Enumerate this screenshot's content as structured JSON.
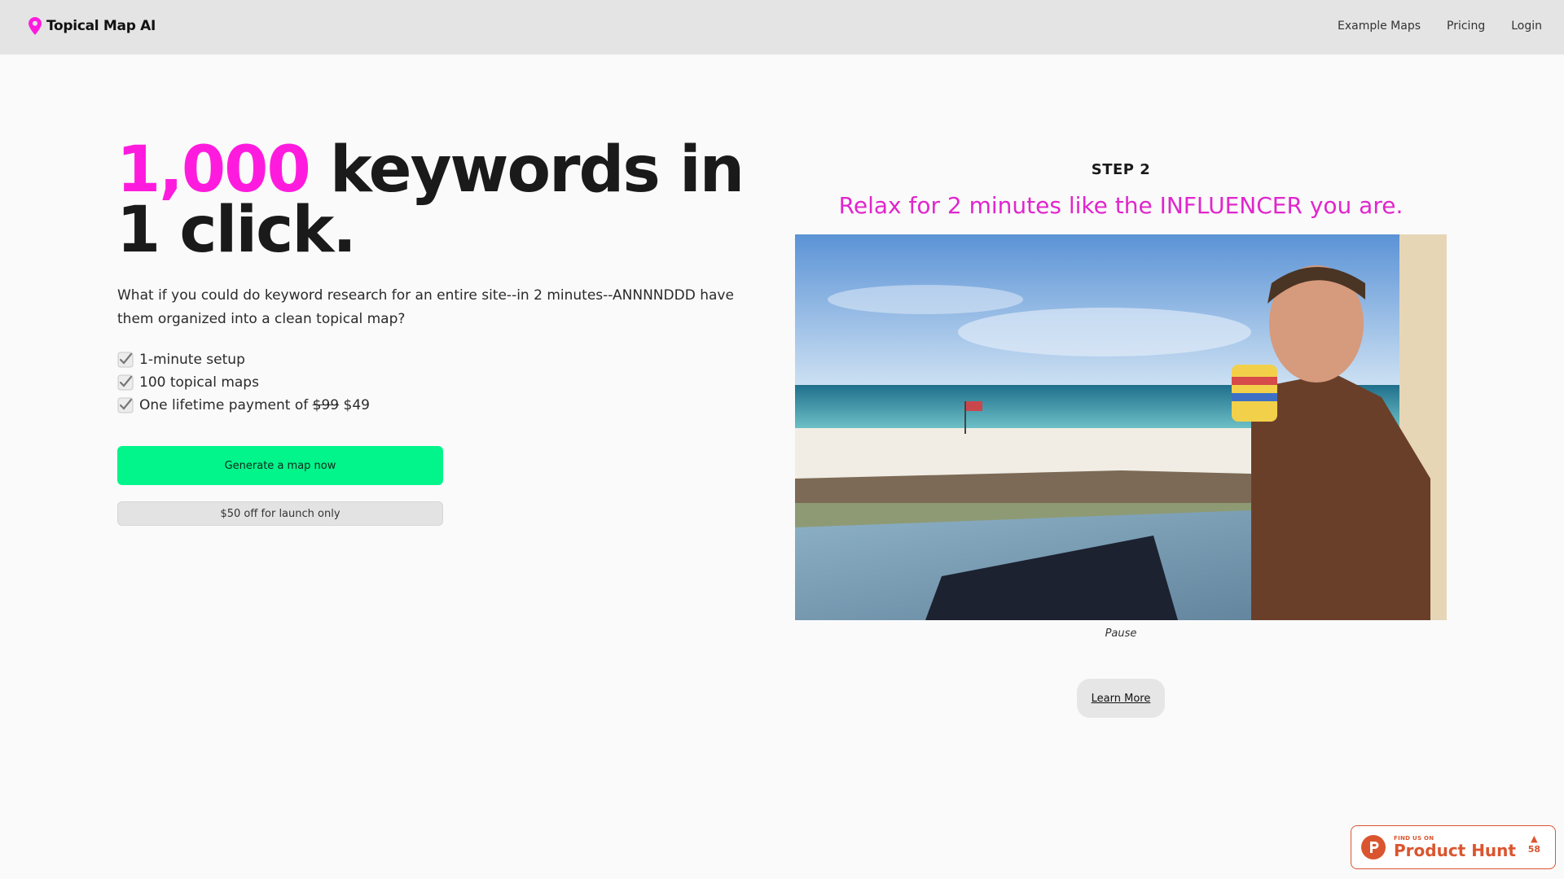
{
  "nav": {
    "brand": "Topical Map AI",
    "links": [
      "Example Maps",
      "Pricing",
      "Login"
    ]
  },
  "hero": {
    "heading_accent": "1,000",
    "heading_rest": " keywords in 1 click.",
    "description": "What if you could do keyword research for an entire site--in 2 minutes--ANNNNDDD have them organized into a clean topical map?",
    "features": {
      "setup": "1-minute setup",
      "maps": "100 topical maps",
      "payment_prefix": "One lifetime payment of ",
      "old_price": "$99",
      "new_price": " $49"
    },
    "cta_label": "Generate a map now",
    "promo_label": "$50 off for launch only"
  },
  "step": {
    "label": "STEP 2",
    "subtitle": "Relax for 2 minutes like the INFLUENCER you are.",
    "video_caption": "Pause",
    "learn_more": "Learn More"
  },
  "product_hunt": {
    "small": "FIND US ON",
    "name": "Product Hunt",
    "votes": "58"
  },
  "colors": {
    "accent_pink": "#ff1bde",
    "cta_green": "#02f58b",
    "product_hunt": "#da552f"
  }
}
